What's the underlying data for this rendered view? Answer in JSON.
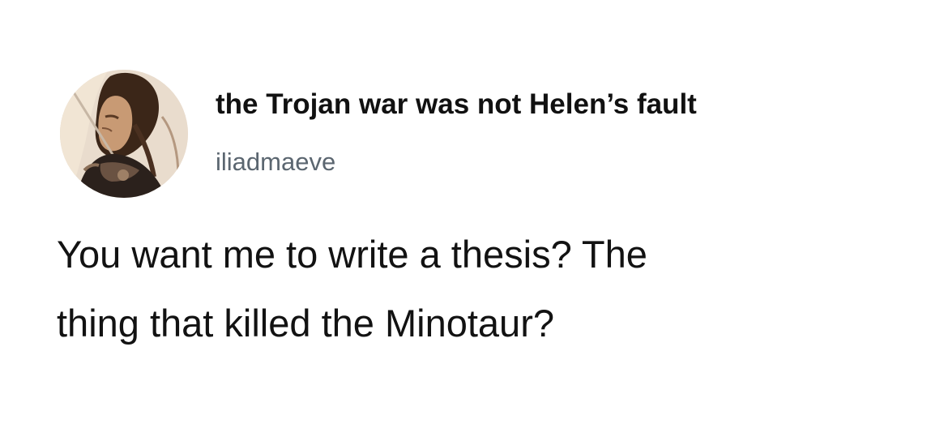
{
  "tweet": {
    "display_name": "the Trojan war was not Helen’s fault",
    "handle": "iliadmaeve",
    "text_lines": [
      "You want me to write a thesis? The",
      "thing that killed the Minotaur?"
    ]
  },
  "avatar": {
    "icon": "profile-avatar-icon",
    "palette": {
      "background": "#e9dccd",
      "hair": "#3b2618",
      "skin": "#c89a74",
      "armor": "#2b211c"
    }
  }
}
